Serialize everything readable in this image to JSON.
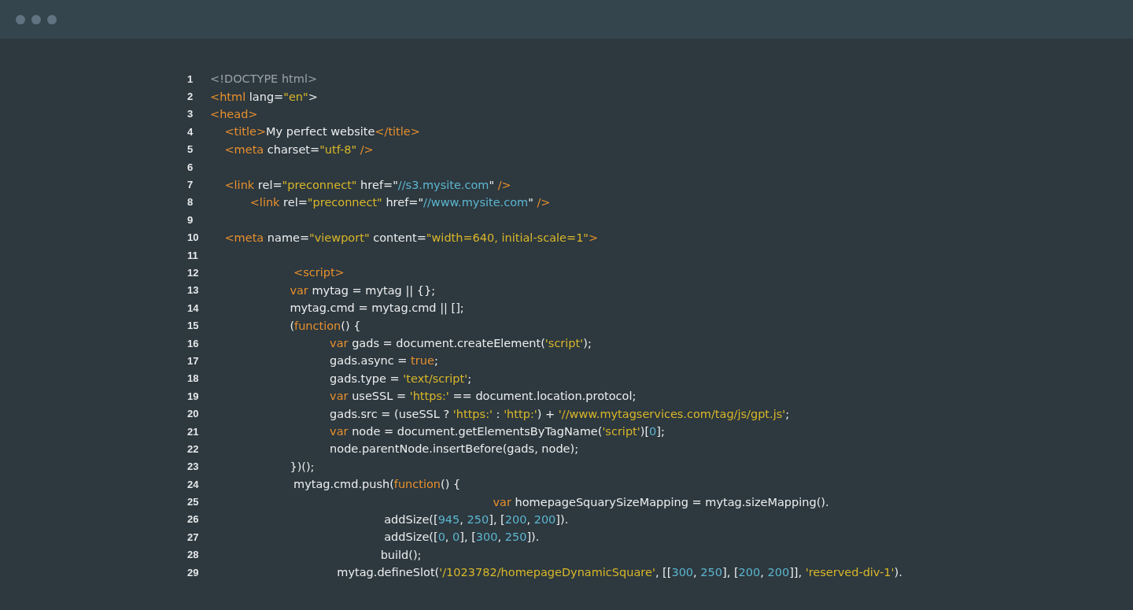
{
  "lines": [
    {
      "number": "1",
      "tokens": [
        {
          "kind": "comment",
          "text": "<!DOCTYPE html>"
        }
      ]
    },
    {
      "number": "2",
      "tokens": [
        {
          "kind": "tag",
          "text": "<html"
        },
        {
          "kind": "plain",
          "text": " lang="
        },
        {
          "kind": "string",
          "text": "\"en\""
        },
        {
          "kind": "plain",
          "text": ">"
        }
      ]
    },
    {
      "number": "3",
      "tokens": [
        {
          "kind": "tag",
          "text": "<head>"
        }
      ]
    },
    {
      "number": "4",
      "tokens": [
        {
          "kind": "tag",
          "text": "    <title>"
        },
        {
          "kind": "plain",
          "text": "My perfect website"
        },
        {
          "kind": "tag",
          "text": "</title>"
        }
      ]
    },
    {
      "number": "5",
      "tokens": [
        {
          "kind": "tag",
          "text": "    <meta"
        },
        {
          "kind": "plain",
          "text": " charset="
        },
        {
          "kind": "string",
          "text": "\"utf-8\""
        },
        {
          "kind": "tag",
          "text": " />"
        }
      ]
    },
    {
      "number": "6"
    },
    {
      "number": "7",
      "tokens": [
        {
          "kind": "tag",
          "text": "    <link"
        },
        {
          "kind": "plain",
          "text": " rel="
        },
        {
          "kind": "string",
          "text": "\"preconnect\""
        },
        {
          "kind": "plain",
          "text": " href=\""
        },
        {
          "kind": "url",
          "text": "//s3.mysite.com"
        },
        {
          "kind": "plain",
          "text": "\""
        },
        {
          "kind": "tag",
          "text": " />"
        }
      ]
    },
    {
      "number": "8",
      "tokens": [
        {
          "kind": "tag",
          "text": "           <link"
        },
        {
          "kind": "plain",
          "text": " rel="
        },
        {
          "kind": "string",
          "text": "\"preconnect\""
        },
        {
          "kind": "plain",
          "text": " href=\""
        },
        {
          "kind": "url",
          "text": "//www.mysite.com"
        },
        {
          "kind": "plain",
          "text": "\""
        },
        {
          "kind": "tag",
          "text": " />"
        }
      ]
    },
    {
      "number": "9"
    },
    {
      "number": "10",
      "tokens": [
        {
          "kind": "tag",
          "text": "    <meta"
        },
        {
          "kind": "plain",
          "text": " name="
        },
        {
          "kind": "string",
          "text": "\"viewport\""
        },
        {
          "kind": "plain",
          "text": " content="
        },
        {
          "kind": "string",
          "text": "\"width=640, initial-scale=1\""
        },
        {
          "kind": "tag",
          "text": ">"
        }
      ]
    },
    {
      "number": "11"
    },
    {
      "number": "12",
      "tokens": [
        {
          "kind": "tag",
          "text": "                       <script>"
        }
      ]
    },
    {
      "number": "13",
      "tokens": [
        {
          "kind": "keyword",
          "text": "                      var"
        },
        {
          "kind": "plain",
          "text": " mytag = mytag || {};"
        }
      ]
    },
    {
      "number": "14",
      "tokens": [
        {
          "kind": "plain",
          "text": "                      mytag.cmd = mytag.cmd || [];"
        }
      ]
    },
    {
      "number": "15",
      "tokens": [
        {
          "kind": "plain",
          "text": "                      ("
        },
        {
          "kind": "keyword",
          "text": "function"
        },
        {
          "kind": "plain",
          "text": "() {"
        }
      ]
    },
    {
      "number": "16",
      "tokens": [
        {
          "kind": "keyword",
          "text": "                                 var"
        },
        {
          "kind": "plain",
          "text": " gads = document.createElement("
        },
        {
          "kind": "string",
          "text": "'script'"
        },
        {
          "kind": "plain",
          "text": ");"
        }
      ]
    },
    {
      "number": "17",
      "tokens": [
        {
          "kind": "plain",
          "text": "                                 gads.async = "
        },
        {
          "kind": "keyword",
          "text": "true"
        },
        {
          "kind": "plain",
          "text": ";"
        }
      ]
    },
    {
      "number": "18",
      "tokens": [
        {
          "kind": "plain",
          "text": "                                 gads.type = "
        },
        {
          "kind": "string",
          "text": "'text/script'"
        },
        {
          "kind": "plain",
          "text": ";"
        }
      ]
    },
    {
      "number": "19",
      "tokens": [
        {
          "kind": "keyword",
          "text": "                                 var"
        },
        {
          "kind": "plain",
          "text": " useSSL = "
        },
        {
          "kind": "string",
          "text": "'https:'"
        },
        {
          "kind": "plain",
          "text": " == document.location.protocol;"
        }
      ]
    },
    {
      "number": "20",
      "tokens": [
        {
          "kind": "plain",
          "text": "                                 gads.src = (useSSL ? "
        },
        {
          "kind": "string",
          "text": "'https:'"
        },
        {
          "kind": "plain",
          "text": " : "
        },
        {
          "kind": "string",
          "text": "'http:'"
        },
        {
          "kind": "plain",
          "text": ") + "
        },
        {
          "kind": "string",
          "text": "'//www.mytagservices.com/tag/js/gpt.js'"
        },
        {
          "kind": "plain",
          "text": ";"
        }
      ]
    },
    {
      "number": "21",
      "tokens": [
        {
          "kind": "keyword",
          "text": "                                 var"
        },
        {
          "kind": "plain",
          "text": " node = document.getElementsByTagName("
        },
        {
          "kind": "string",
          "text": "'script'"
        },
        {
          "kind": "plain",
          "text": ")["
        },
        {
          "kind": "number",
          "text": "0"
        },
        {
          "kind": "plain",
          "text": "];"
        }
      ]
    },
    {
      "number": "22",
      "tokens": [
        {
          "kind": "plain",
          "text": "                                 node.parentNode.insertBefore(gads, node);"
        }
      ]
    },
    {
      "number": "23",
      "tokens": [
        {
          "kind": "plain",
          "text": "                      })();"
        }
      ]
    },
    {
      "number": "24",
      "tokens": [
        {
          "kind": "plain",
          "text": "                       mytag.cmd.push("
        },
        {
          "kind": "keyword",
          "text": "function"
        },
        {
          "kind": "plain",
          "text": "() {"
        }
      ]
    },
    {
      "number": "25",
      "tokens": [
        {
          "kind": "keyword",
          "text": "                                                                              var"
        },
        {
          "kind": "plain",
          "text": " homepageSquarySizeMapping = mytag.sizeMapping()."
        }
      ]
    },
    {
      "number": "26",
      "tokens": [
        {
          "kind": "plain",
          "text": "                                                addSize(["
        },
        {
          "kind": "number",
          "text": "945"
        },
        {
          "kind": "plain",
          "text": ", "
        },
        {
          "kind": "number",
          "text": "250"
        },
        {
          "kind": "plain",
          "text": "], ["
        },
        {
          "kind": "number",
          "text": "200"
        },
        {
          "kind": "plain",
          "text": ", "
        },
        {
          "kind": "number",
          "text": "200"
        },
        {
          "kind": "plain",
          "text": "])."
        }
      ]
    },
    {
      "number": "27",
      "tokens": [
        {
          "kind": "plain",
          "text": "                                                addSize(["
        },
        {
          "kind": "number",
          "text": "0"
        },
        {
          "kind": "plain",
          "text": ", "
        },
        {
          "kind": "number",
          "text": "0"
        },
        {
          "kind": "plain",
          "text": "], ["
        },
        {
          "kind": "number",
          "text": "300"
        },
        {
          "kind": "plain",
          "text": ", "
        },
        {
          "kind": "number",
          "text": "250"
        },
        {
          "kind": "plain",
          "text": "])."
        }
      ]
    },
    {
      "number": "28",
      "tokens": [
        {
          "kind": "plain",
          "text": "                                               build();"
        }
      ]
    },
    {
      "number": "29",
      "tokens": [
        {
          "kind": "plain",
          "text": "                                   mytag.defineSlot("
        },
        {
          "kind": "string",
          "text": "'/1023782/homepageDynamicSquare'"
        },
        {
          "kind": "plain",
          "text": ", [["
        },
        {
          "kind": "number",
          "text": "300"
        },
        {
          "kind": "plain",
          "text": ", "
        },
        {
          "kind": "number",
          "text": "250"
        },
        {
          "kind": "plain",
          "text": "], ["
        },
        {
          "kind": "number",
          "text": "200"
        },
        {
          "kind": "plain",
          "text": ", "
        },
        {
          "kind": "number",
          "text": "200"
        },
        {
          "kind": "plain",
          "text": "]], "
        },
        {
          "kind": "string",
          "text": "'reserved-div-1'"
        },
        {
          "kind": "plain",
          "text": ")."
        }
      ]
    }
  ]
}
